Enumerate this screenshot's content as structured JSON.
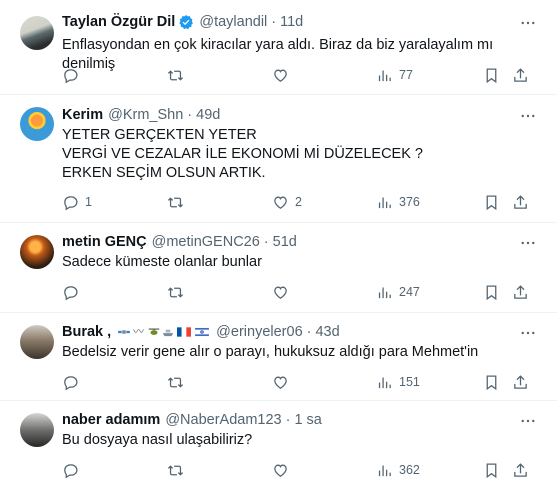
{
  "tweets": [
    {
      "name": "Taylan Özgür Dil",
      "handle": "@taylandil",
      "dot": "·",
      "time": "11d",
      "text": "Enflasyondan en çok kiracılar yara aldı. Biraz da biz yaralayalım mı denilmiş",
      "replies": "",
      "retweets": "",
      "likes": "",
      "views": "77"
    },
    {
      "name": "Kerim",
      "handle": "@Krm_Shn",
      "dot": "·",
      "time": "49d",
      "text": "YETER GERÇEKTEN YETER\nVERGİ VE CEZALAR İLE EKONOMİ Mİ DÜZELECEK ?\nERKEN SEÇİM OLSUN ARTIK.",
      "replies": "1",
      "retweets": "",
      "likes": "2",
      "views": "376"
    },
    {
      "name": "metin GENÇ",
      "handle": "@metinGENC26",
      "dot": "·",
      "time": "51d",
      "text": "Sadece kümeste olanlar bunlar",
      "replies": "",
      "retweets": "",
      "likes": "",
      "views": "247"
    },
    {
      "name": "Burak ,",
      "handle": "@erinyeler06",
      "dot": "·",
      "time": "43d",
      "deco": "〰",
      "text": "Bedelsiz verir gene alır o parayı, hukuksuz aldığı para Mehmet'in",
      "replies": "",
      "retweets": "",
      "likes": "",
      "views": "151"
    },
    {
      "name": "naber adamım",
      "handle": "@NaberAdam123",
      "dot": "·",
      "time": "1 sa",
      "text": "Bu dosyaya nasıl ulaşabiliriz?",
      "replies": "",
      "retweets": "",
      "likes": "",
      "views": "362"
    }
  ],
  "colors": {
    "secondary": "#536471",
    "verified": "#1d9bf0",
    "divider": "#eff3f4"
  },
  "icons": [
    "more-icon",
    "reply-icon",
    "retweet-icon",
    "like-icon",
    "views-icon",
    "bookmark-icon",
    "share-icon",
    "verified-icon"
  ]
}
